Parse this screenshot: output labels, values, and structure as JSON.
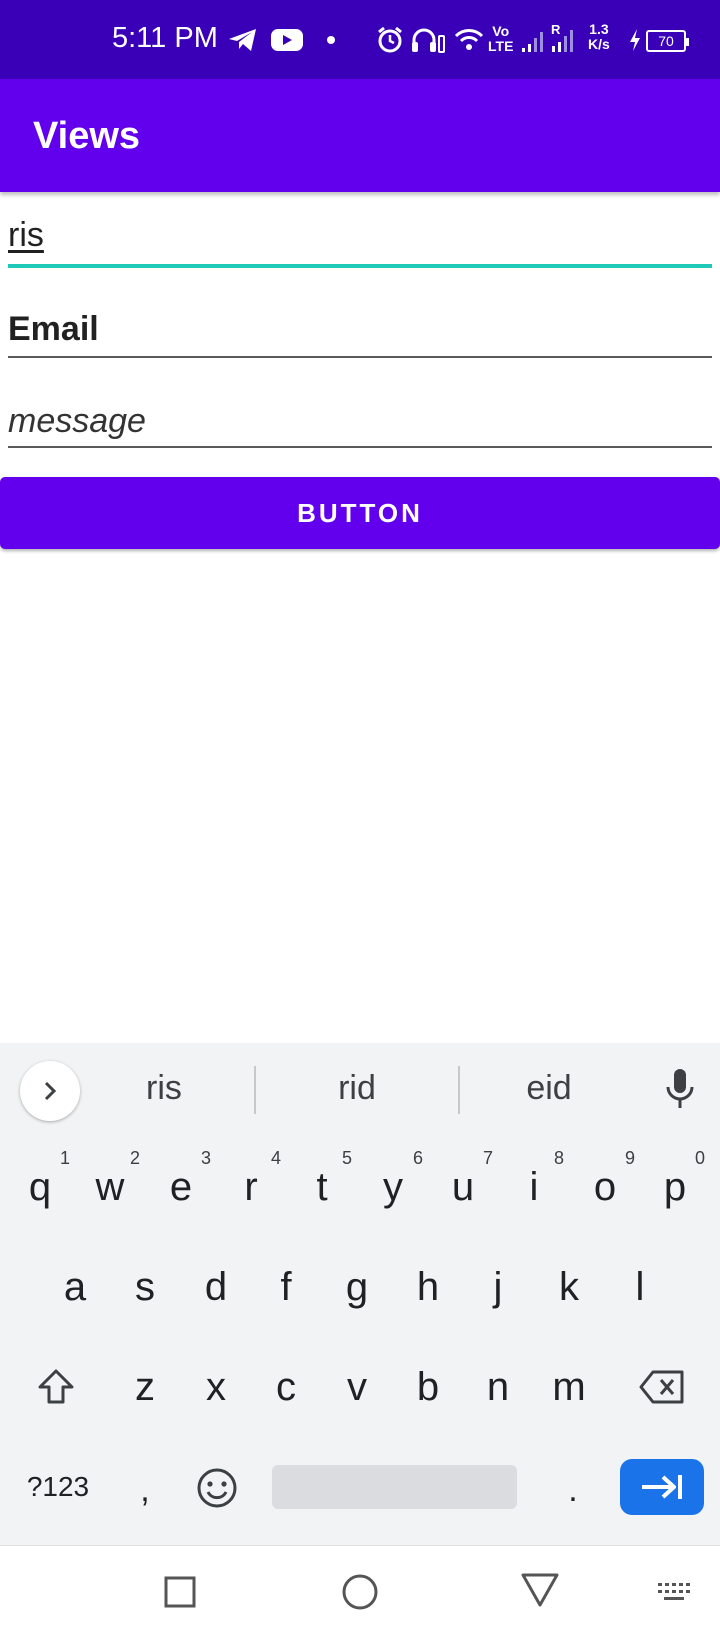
{
  "status_bar": {
    "time": "5:11 PM",
    "icons": [
      "telegram-icon",
      "youtube-icon",
      "dot-icon",
      "alarm-icon",
      "headphones-icon",
      "wifi-icon",
      "signal-icon",
      "signal-roaming-icon"
    ],
    "volte_top": "Vo",
    "volte_bottom": "LTE",
    "roaming": "R",
    "speed_top": "1.3",
    "speed_bottom": "K/s",
    "battery": "70"
  },
  "app_bar": {
    "title": "Views"
  },
  "form": {
    "name_value": "ris",
    "email_hint": "Email",
    "message_hint": "message",
    "button_label": "BUTTON"
  },
  "keyboard": {
    "suggestions": [
      "ris",
      "rid",
      "eid"
    ],
    "row1": [
      {
        "k": "q",
        "h": "1"
      },
      {
        "k": "w",
        "h": "2"
      },
      {
        "k": "e",
        "h": "3"
      },
      {
        "k": "r",
        "h": "4"
      },
      {
        "k": "t",
        "h": "5"
      },
      {
        "k": "y",
        "h": "6"
      },
      {
        "k": "u",
        "h": "7"
      },
      {
        "k": "i",
        "h": "8"
      },
      {
        "k": "o",
        "h": "9"
      },
      {
        "k": "p",
        "h": "0"
      }
    ],
    "row2": [
      "a",
      "s",
      "d",
      "f",
      "g",
      "h",
      "j",
      "k",
      "l"
    ],
    "row3": [
      "z",
      "x",
      "c",
      "v",
      "b",
      "n",
      "m"
    ],
    "symbols_label": "?123",
    "comma": ",",
    "period": ".",
    "accent_color": "#1a73e8"
  },
  "colors": {
    "status_bar": "#3a00b8",
    "app_bar": "#6200ee",
    "focus_line": "#1fc9b8"
  }
}
